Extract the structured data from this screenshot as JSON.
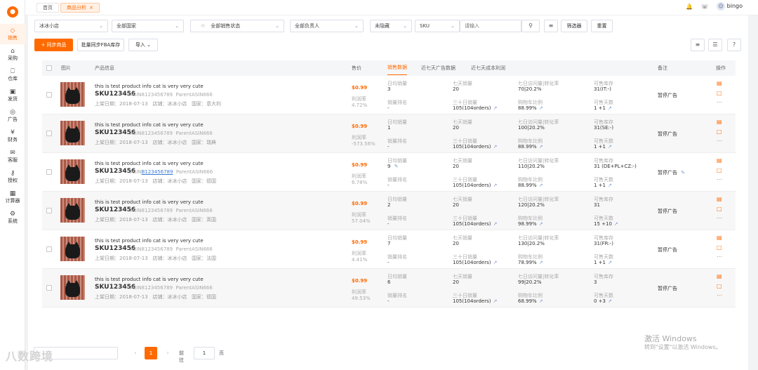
{
  "sidebar": {
    "items": [
      {
        "label": "销售",
        "icon": "tag-icon"
      },
      {
        "label": "采购",
        "icon": "cart-icon"
      },
      {
        "label": "仓库",
        "icon": "warehouse-icon"
      },
      {
        "label": "发货",
        "icon": "truck-icon"
      },
      {
        "label": "广告",
        "icon": "ad-icon"
      },
      {
        "label": "财务",
        "icon": "yen-icon"
      },
      {
        "label": "客服",
        "icon": "mail-icon"
      },
      {
        "label": "授权",
        "icon": "key-icon"
      },
      {
        "label": "计算器",
        "icon": "calculator-icon"
      },
      {
        "label": "系统",
        "icon": "gear-icon"
      }
    ]
  },
  "tabs": {
    "home": "首页",
    "current": "商品分析",
    "close": "×"
  },
  "user": {
    "name": "bingo"
  },
  "filters": {
    "shop": "冰冰小店",
    "country": "全部国家",
    "sales_status": "全部销售状态",
    "owner": "全部负责人",
    "hidden": "未隐藏",
    "search_type": "SKU",
    "search_placeholder": "请输入",
    "filter_btn": "筛选器",
    "reset_btn": "重置"
  },
  "actions": {
    "sync": "+ 同步商品",
    "batch_fba": "批量同步FBA库存",
    "import": "导入"
  },
  "table": {
    "headers": {
      "image": "图片",
      "product": "产品信息",
      "price": "售价",
      "sales_data": "销售数据",
      "ad_data": "近七天广告数据",
      "cost_profit": "近七天成本利润",
      "remark": "备注",
      "ops": "操作"
    },
    "labels": {
      "profit": "利润率",
      "daily": "日均销量",
      "rank": "销量排名",
      "seven": "七天销量",
      "thirty": "三十日销量",
      "conv": "七日访问量|转化率",
      "buybox": "购物车比例",
      "stock": "可售库存",
      "days": "可售天数"
    },
    "rows": [
      {
        "title": "this is test product info cat is very very cute",
        "sku": "SKU123456",
        "asin": "ASIN8123456789",
        "parent": "ParentASIN666",
        "date": "上架日期：2018-07-13",
        "store": "店铺：冰冰小店",
        "country": "国家：意大利",
        "price": "$0.99",
        "profit": "4.72%",
        "daily": "3",
        "rank": "-",
        "seven": "20",
        "thirty": "105(104orders)",
        "conv": "70|20.2%",
        "buybox": "88.99%",
        "stock": "31(IT:-)",
        "days": "1 +1",
        "remark": "暂停广告"
      },
      {
        "title": "this is test product info cat is very very cute",
        "sku": "SKU123456",
        "asin": "ASIN8123456789",
        "parent": "ParentASIN666",
        "date": "上架日期：2018-07-13",
        "store": "店铺：冰冰小店",
        "country": "国家：瑞典",
        "price": "$0.99",
        "profit": "-573.56%",
        "daily": "1",
        "rank": "-",
        "seven": "20",
        "thirty": "105(104orders)",
        "conv": "100|20.2%",
        "buybox": "88.99%",
        "stock": "31(SE:-)",
        "days": "1 +1",
        "remark": "暂停广告"
      },
      {
        "title": "this is test product info cat is very very cute",
        "sku": "SKU123456",
        "asin": "ASIN8123456789",
        "parent": "ParentASIN666",
        "date": "上架日期：2018-07-13",
        "store": "店铺：冰冰小店",
        "country": "国家：德国",
        "price": "$0.99",
        "profit": "6.78%",
        "daily": "9",
        "rank": "-",
        "seven": "20",
        "thirty": "105(104orders)",
        "conv": "110|20.2%",
        "buybox": "88.99%",
        "stock": "31 (DE+PL+CZ:-)",
        "days": "1 +1",
        "remark": "暂停广告"
      },
      {
        "title": "this is test product info cat is very very cute",
        "sku": "SKU123456",
        "asin": "ASIN8123456789",
        "parent": "ParentASIN666",
        "date": "上架日期：2018-07-13",
        "store": "店铺：冰冰小店",
        "country": "国家：英国",
        "price": "$0.99",
        "profit": "57.04%",
        "daily": "2",
        "rank": "-",
        "seven": "20",
        "thirty": "105(104orders)",
        "conv": "120|20.2%",
        "buybox": "98.99%",
        "stock": "31",
        "days": "15 +10",
        "remark": "暂停广告"
      },
      {
        "title": "this is test product info cat is very very cute",
        "sku": "SKU123456",
        "asin": "ASIN8123456789",
        "parent": "ParentASIN666",
        "date": "上架日期：2018-07-13",
        "store": "店铺：冰冰小店",
        "country": "国家：法国",
        "price": "$0.99",
        "profit": "4.41%",
        "daily": "7",
        "rank": "-",
        "seven": "20",
        "thirty": "105(104orders)",
        "conv": "130|20.2%",
        "buybox": "78.99%",
        "stock": "31(FR:-)",
        "days": "1 +1",
        "remark": "暂停广告"
      },
      {
        "title": "this is test product info cat is very very cute",
        "sku": "SKU123456",
        "asin": "ASIN8123456789",
        "parent": "ParentASIN666",
        "date": "上架日期：2018-07-13",
        "store": "店铺：冰冰小店",
        "country": "国家：德国",
        "price": "$0.99",
        "profit": "49.53%",
        "daily": "6",
        "rank": "-",
        "seven": "20",
        "thirty": "105(104orders)",
        "conv": "99|20.2%",
        "buybox": "68.99%",
        "stock": "3",
        "days": "0 +3",
        "remark": "暂停广告"
      }
    ]
  },
  "pagination": {
    "current": "1",
    "goto": "前往",
    "page_input": "1",
    "page_suffix": "页",
    "prev": "‹",
    "next": "›"
  },
  "watermark": {
    "line1": "激活 Windows",
    "line2": "转到\"设置\"以激活 Windows。",
    "brand": "八数跨境"
  },
  "colors": {
    "accent": "#ff6a00"
  }
}
